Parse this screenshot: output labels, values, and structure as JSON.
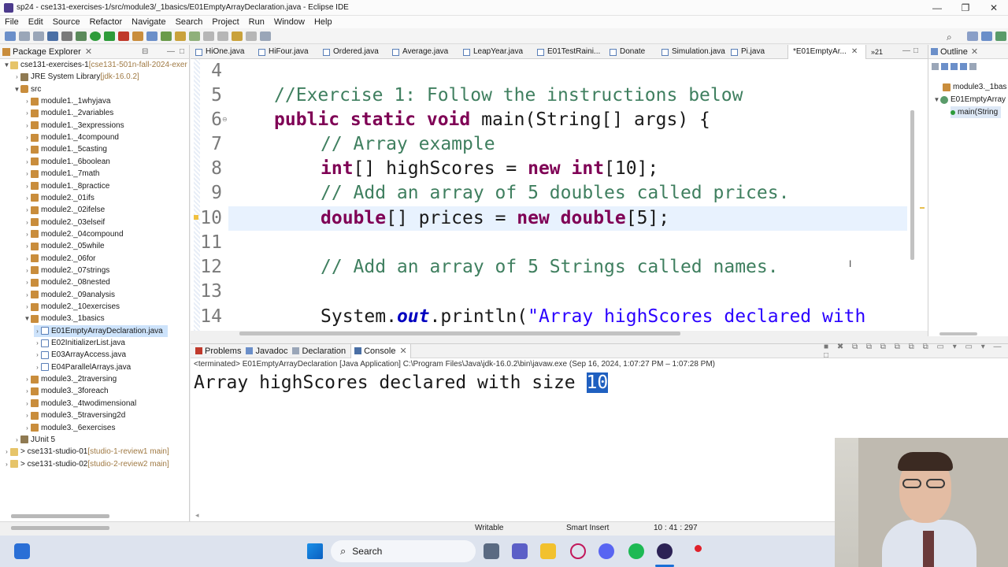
{
  "window": {
    "title": "sp24 - cse131-exercises-1/src/module3/_1basics/E01EmptyArrayDeclaration.java - Eclipse IDE"
  },
  "menu": [
    "File",
    "Edit",
    "Source",
    "Refactor",
    "Navigate",
    "Search",
    "Project",
    "Run",
    "Window",
    "Help"
  ],
  "package_explorer": {
    "title": "Package Explorer",
    "items": [
      {
        "label": "cse131-exercises-1",
        "suffix": " [cse131-501n-fall-2024-exer",
        "depth": 0,
        "type": "proj",
        "tw": "▼"
      },
      {
        "label": "JRE System Library",
        "suffix": " [jdk-16.0.2]",
        "depth": 1,
        "type": "lib",
        "tw": "›"
      },
      {
        "label": "src",
        "suffix": "",
        "depth": 1,
        "type": "src",
        "tw": "▼"
      },
      {
        "label": "module1._1whyjava",
        "suffix": "",
        "depth": 2,
        "type": "pkg",
        "tw": "›"
      },
      {
        "label": "module1._2variables",
        "suffix": "",
        "depth": 2,
        "type": "pkg",
        "tw": "›"
      },
      {
        "label": "module1._3expressions",
        "suffix": "",
        "depth": 2,
        "type": "pkg",
        "tw": "›"
      },
      {
        "label": "module1._4compound",
        "suffix": "",
        "depth": 2,
        "type": "pkg",
        "tw": "›"
      },
      {
        "label": "module1._5casting",
        "suffix": "",
        "depth": 2,
        "type": "pkg",
        "tw": "›"
      },
      {
        "label": "module1._6boolean",
        "suffix": "",
        "depth": 2,
        "type": "pkg",
        "tw": "›"
      },
      {
        "label": "module1._7math",
        "suffix": "",
        "depth": 2,
        "type": "pkg",
        "tw": "›"
      },
      {
        "label": "module1._8practice",
        "suffix": "",
        "depth": 2,
        "type": "pkg",
        "tw": "›"
      },
      {
        "label": "module2._01ifs",
        "suffix": "",
        "depth": 2,
        "type": "pkg",
        "tw": "›"
      },
      {
        "label": "module2._02ifelse",
        "suffix": "",
        "depth": 2,
        "type": "pkg",
        "tw": "›"
      },
      {
        "label": "module2._03elseif",
        "suffix": "",
        "depth": 2,
        "type": "pkg",
        "tw": "›"
      },
      {
        "label": "module2._04compound",
        "suffix": "",
        "depth": 2,
        "type": "pkg",
        "tw": "›"
      },
      {
        "label": "module2._05while",
        "suffix": "",
        "depth": 2,
        "type": "pkg",
        "tw": "›"
      },
      {
        "label": "module2._06for",
        "suffix": "",
        "depth": 2,
        "type": "pkg",
        "tw": "›"
      },
      {
        "label": "module2._07strings",
        "suffix": "",
        "depth": 2,
        "type": "pkg",
        "tw": "›"
      },
      {
        "label": "module2._08nested",
        "suffix": "",
        "depth": 2,
        "type": "pkg",
        "tw": "›"
      },
      {
        "label": "module2._09analysis",
        "suffix": "",
        "depth": 2,
        "type": "pkg",
        "tw": "›"
      },
      {
        "label": "module2._10exercises",
        "suffix": "",
        "depth": 2,
        "type": "pkg",
        "tw": "›"
      },
      {
        "label": "module3._1basics",
        "suffix": "",
        "depth": 2,
        "type": "pkg",
        "tw": "▼"
      },
      {
        "label": "E01EmptyArrayDeclaration.java",
        "suffix": "",
        "depth": 3,
        "type": "java",
        "tw": "›",
        "selected": true
      },
      {
        "label": "E02InitializerList.java",
        "suffix": "",
        "depth": 3,
        "type": "java",
        "tw": "›"
      },
      {
        "label": "E03ArrayAccess.java",
        "suffix": "",
        "depth": 3,
        "type": "java",
        "tw": "›"
      },
      {
        "label": "E04ParallelArrays.java",
        "suffix": "",
        "depth": 3,
        "type": "java",
        "tw": "›"
      },
      {
        "label": "module3._2traversing",
        "suffix": "",
        "depth": 2,
        "type": "pkg",
        "tw": "›"
      },
      {
        "label": "module3._3foreach",
        "suffix": "",
        "depth": 2,
        "type": "pkg",
        "tw": "›"
      },
      {
        "label": "module3._4twodimensional",
        "suffix": "",
        "depth": 2,
        "type": "pkg",
        "tw": "›"
      },
      {
        "label": "module3._5traversing2d",
        "suffix": "",
        "depth": 2,
        "type": "pkg",
        "tw": "›"
      },
      {
        "label": "module3._6exercises",
        "suffix": "",
        "depth": 2,
        "type": "pkg",
        "tw": "›"
      },
      {
        "label": "JUnit 5",
        "suffix": "",
        "depth": 1,
        "type": "lib",
        "tw": "›"
      },
      {
        "label": "> cse131-studio-01",
        "suffix": " [studio-1-review1 main]",
        "depth": 0,
        "type": "proj",
        "tw": "›"
      },
      {
        "label": "> cse131-studio-02",
        "suffix": " [studio-2-review2 main]",
        "depth": 0,
        "type": "proj",
        "tw": "›"
      }
    ]
  },
  "editor_tabs": [
    "HiOne.java",
    "HiFour.java",
    "Ordered.java",
    "Average.java",
    "LeapYear.java",
    "E01TestRaini...",
    "Donate",
    "Simulation.java",
    "Pi.java",
    "*E01EmptyAr...",
    "»21"
  ],
  "code": {
    "line_numbers": [
      "4",
      "5",
      "6",
      "7",
      "8",
      "9",
      "10",
      "11",
      "12",
      "13",
      "14"
    ],
    "l5": "//Exercise 1: Follow the instructions below",
    "l6_kw": "public static void",
    "l6_rest": " main(String[] args) {",
    "l7": "// Array example",
    "l8_kw1": "int",
    "l8_mid": "[] highScores = ",
    "l8_kw2": "new int",
    "l8_end": "[10];",
    "l9": "// Add an array of 5 doubles called prices.",
    "l10_kw1": "double",
    "l10_mid": "[] prices = ",
    "l10_kw2": "new double",
    "l10_end": "[5];",
    "l12": "// Add an array of 5 Strings called names.",
    "l14_a": "System.",
    "l14_out": "out",
    "l14_b": ".println(",
    "l14_str": "\"Array highScores declared with"
  },
  "outline": {
    "title": "Outline",
    "items": [
      "module3._1bas",
      "E01EmptyArray",
      "main(String"
    ]
  },
  "console": {
    "tabs": [
      "Problems",
      "Javadoc",
      "Declaration",
      "Console"
    ],
    "terminated": "<terminated> E01EmptyArrayDeclaration [Java Application] C:\\Program Files\\Java\\jdk-16.0.2\\bin\\javaw.exe  (Sep 16, 2024, 1:07:27 PM – 1:07:28 PM)",
    "output_text": "Array highScores declared with size ",
    "output_highlight": "10"
  },
  "status": {
    "writable": "Writable",
    "insert": "Smart Insert",
    "position": "10 : 41 : 297"
  },
  "taskbar": {
    "search": "Search"
  }
}
